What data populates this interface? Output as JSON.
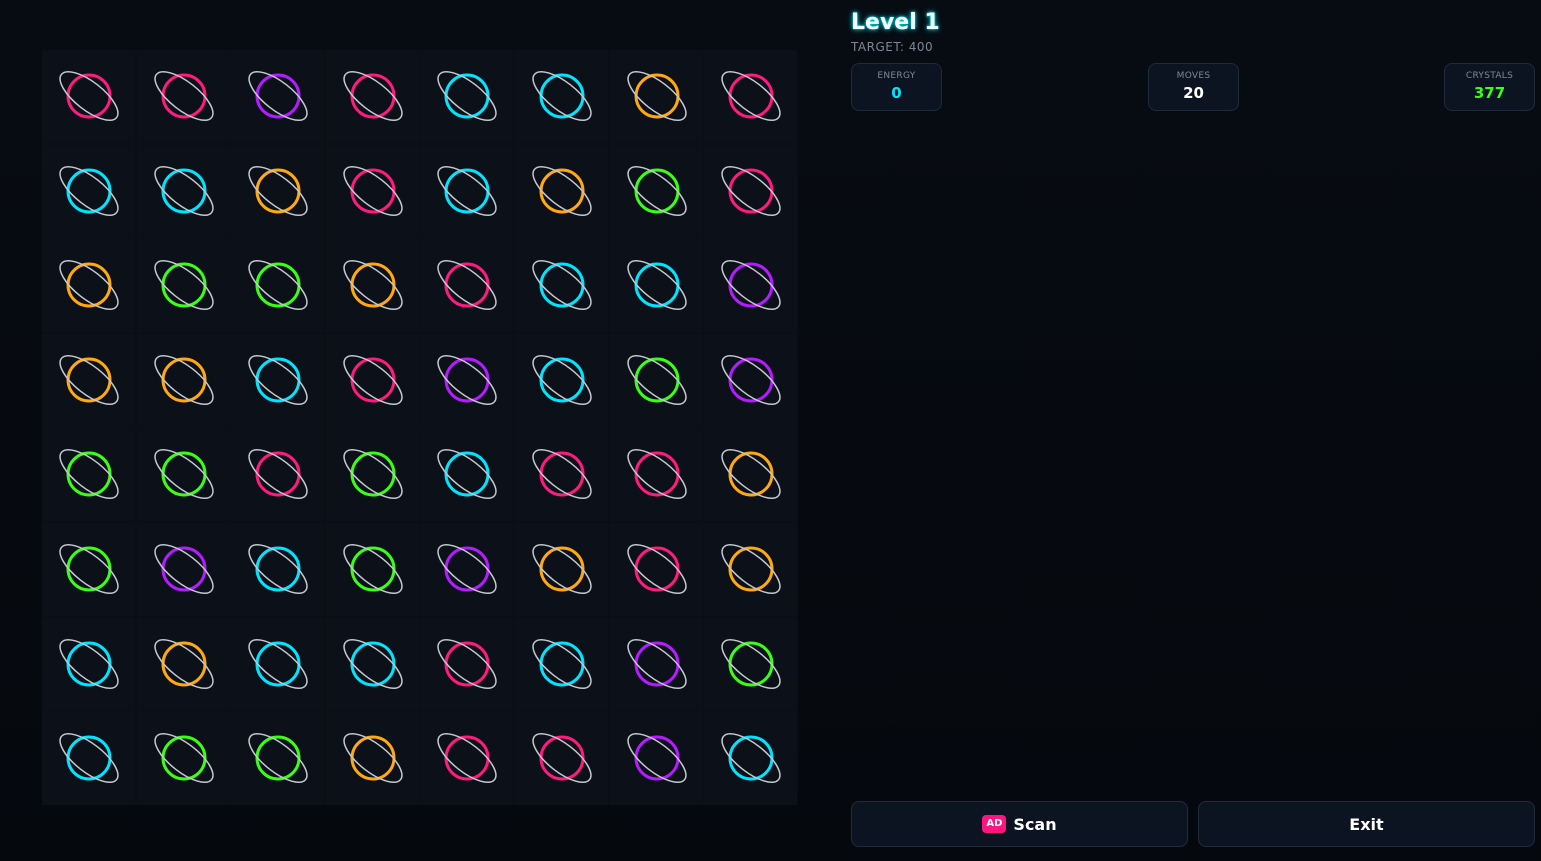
{
  "header": {
    "level_title": "Level 1",
    "target": "TARGET: 400"
  },
  "stats": {
    "energy": {
      "label": "ENERGY",
      "value": "0",
      "color": "#00e5ff"
    },
    "moves": {
      "label": "MOVES",
      "value": "20",
      "color": "#ffffff"
    },
    "crystals": {
      "label": "CRYSTALS",
      "value": "377",
      "color": "#39ff14"
    }
  },
  "buttons": {
    "scan": {
      "badge": "AD",
      "label": "Scan"
    },
    "exit": {
      "label": "Exit"
    }
  },
  "board": {
    "rows": 8,
    "cols": 8,
    "icon": "planet-icon",
    "colors": {
      "pink": "#ff1a7f",
      "purple": "#b41cff",
      "cyan": "#00e5ff",
      "orange": "#ffa90f",
      "green": "#39ff14"
    },
    "grid": [
      [
        "pink",
        "pink",
        "purple",
        "pink",
        "cyan",
        "cyan",
        "orange",
        "pink"
      ],
      [
        "cyan",
        "cyan",
        "orange",
        "pink",
        "cyan",
        "orange",
        "green",
        "pink"
      ],
      [
        "orange",
        "green",
        "green",
        "orange",
        "pink",
        "cyan",
        "cyan",
        "purple"
      ],
      [
        "orange",
        "orange",
        "cyan",
        "pink",
        "purple",
        "cyan",
        "green",
        "purple"
      ],
      [
        "green",
        "green",
        "pink",
        "green",
        "cyan",
        "pink",
        "pink",
        "orange"
      ],
      [
        "green",
        "purple",
        "cyan",
        "green",
        "purple",
        "orange",
        "pink",
        "orange"
      ],
      [
        "cyan",
        "orange",
        "cyan",
        "cyan",
        "pink",
        "cyan",
        "purple",
        "green"
      ],
      [
        "cyan",
        "green",
        "green",
        "orange",
        "pink",
        "pink",
        "purple",
        "cyan"
      ]
    ]
  }
}
